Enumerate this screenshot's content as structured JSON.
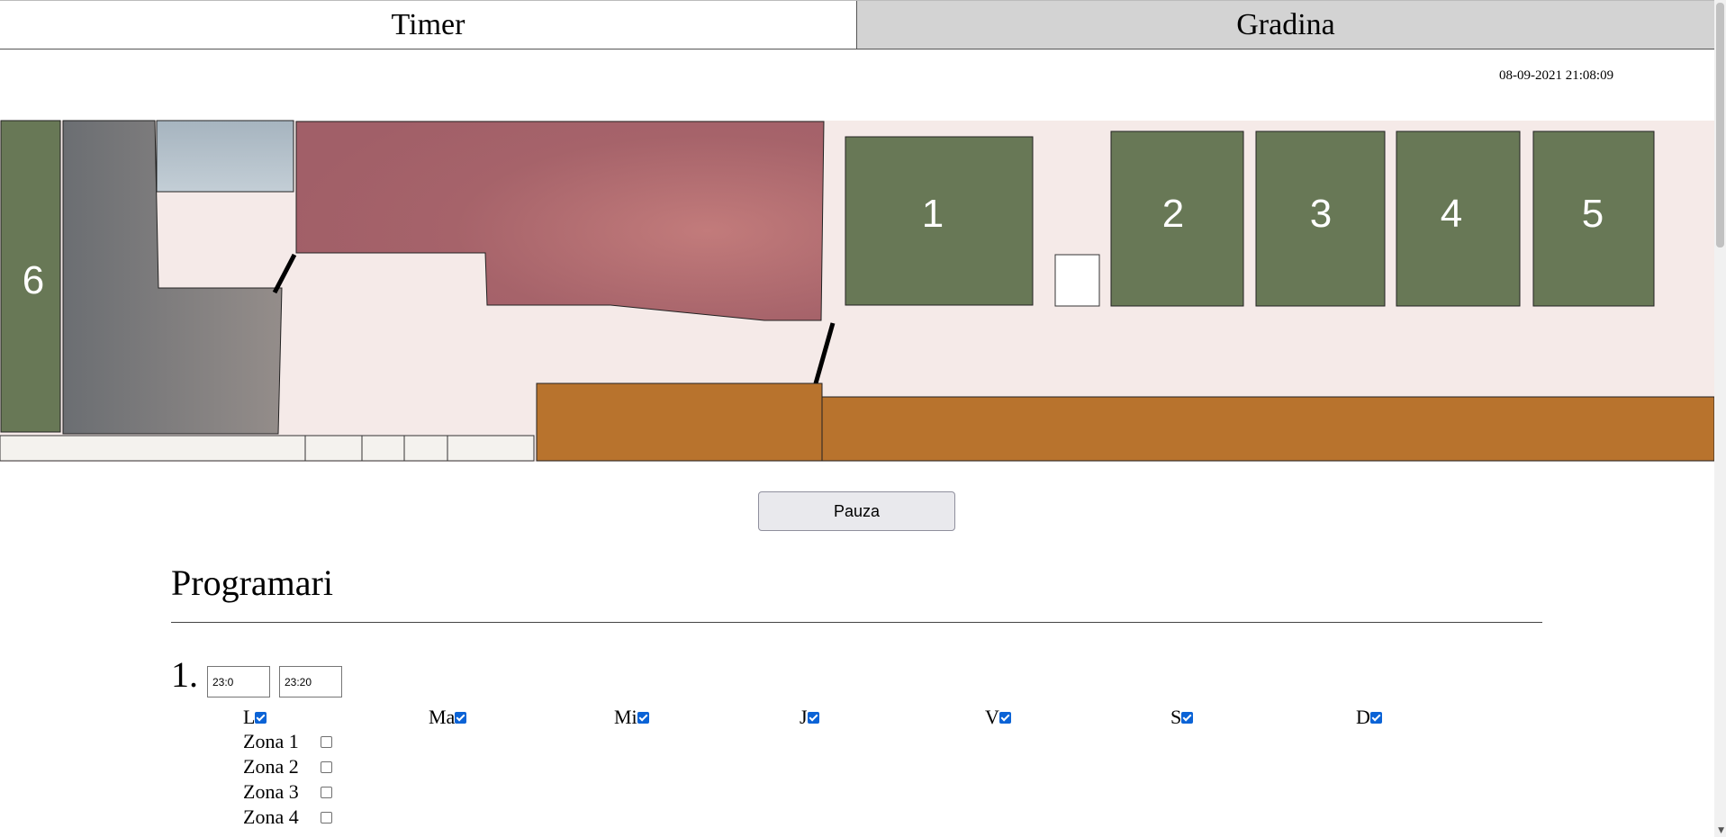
{
  "tabs": [
    {
      "label": "Timer",
      "active": true
    },
    {
      "label": "Gradina",
      "active": false
    }
  ],
  "datetime": "08-09-2021 21:08:09",
  "garden": {
    "beds": [
      "1",
      "2",
      "3",
      "4",
      "5",
      "6"
    ],
    "colors": {
      "background": "#f5eae8",
      "bed": "#687856",
      "house": "#b56d76",
      "terrace": "#b8732d",
      "garage": "#7f7f7f",
      "window": "#b3c0c9"
    }
  },
  "pause_label": "Pauza",
  "section_title": "Programari",
  "programs": [
    {
      "number": "1.",
      "start": "23:0",
      "end": "23:20",
      "days": [
        {
          "label": "L",
          "checked": true
        },
        {
          "label": "Ma",
          "checked": true
        },
        {
          "label": "Mi",
          "checked": true
        },
        {
          "label": "J",
          "checked": true
        },
        {
          "label": "V",
          "checked": true
        },
        {
          "label": "S",
          "checked": true
        },
        {
          "label": "D",
          "checked": true
        }
      ],
      "zones": [
        {
          "label": "Zona 1",
          "checked": false
        },
        {
          "label": "Zona 2",
          "checked": false
        },
        {
          "label": "Zona 3",
          "checked": false
        },
        {
          "label": "Zona 4",
          "checked": false
        }
      ]
    }
  ]
}
